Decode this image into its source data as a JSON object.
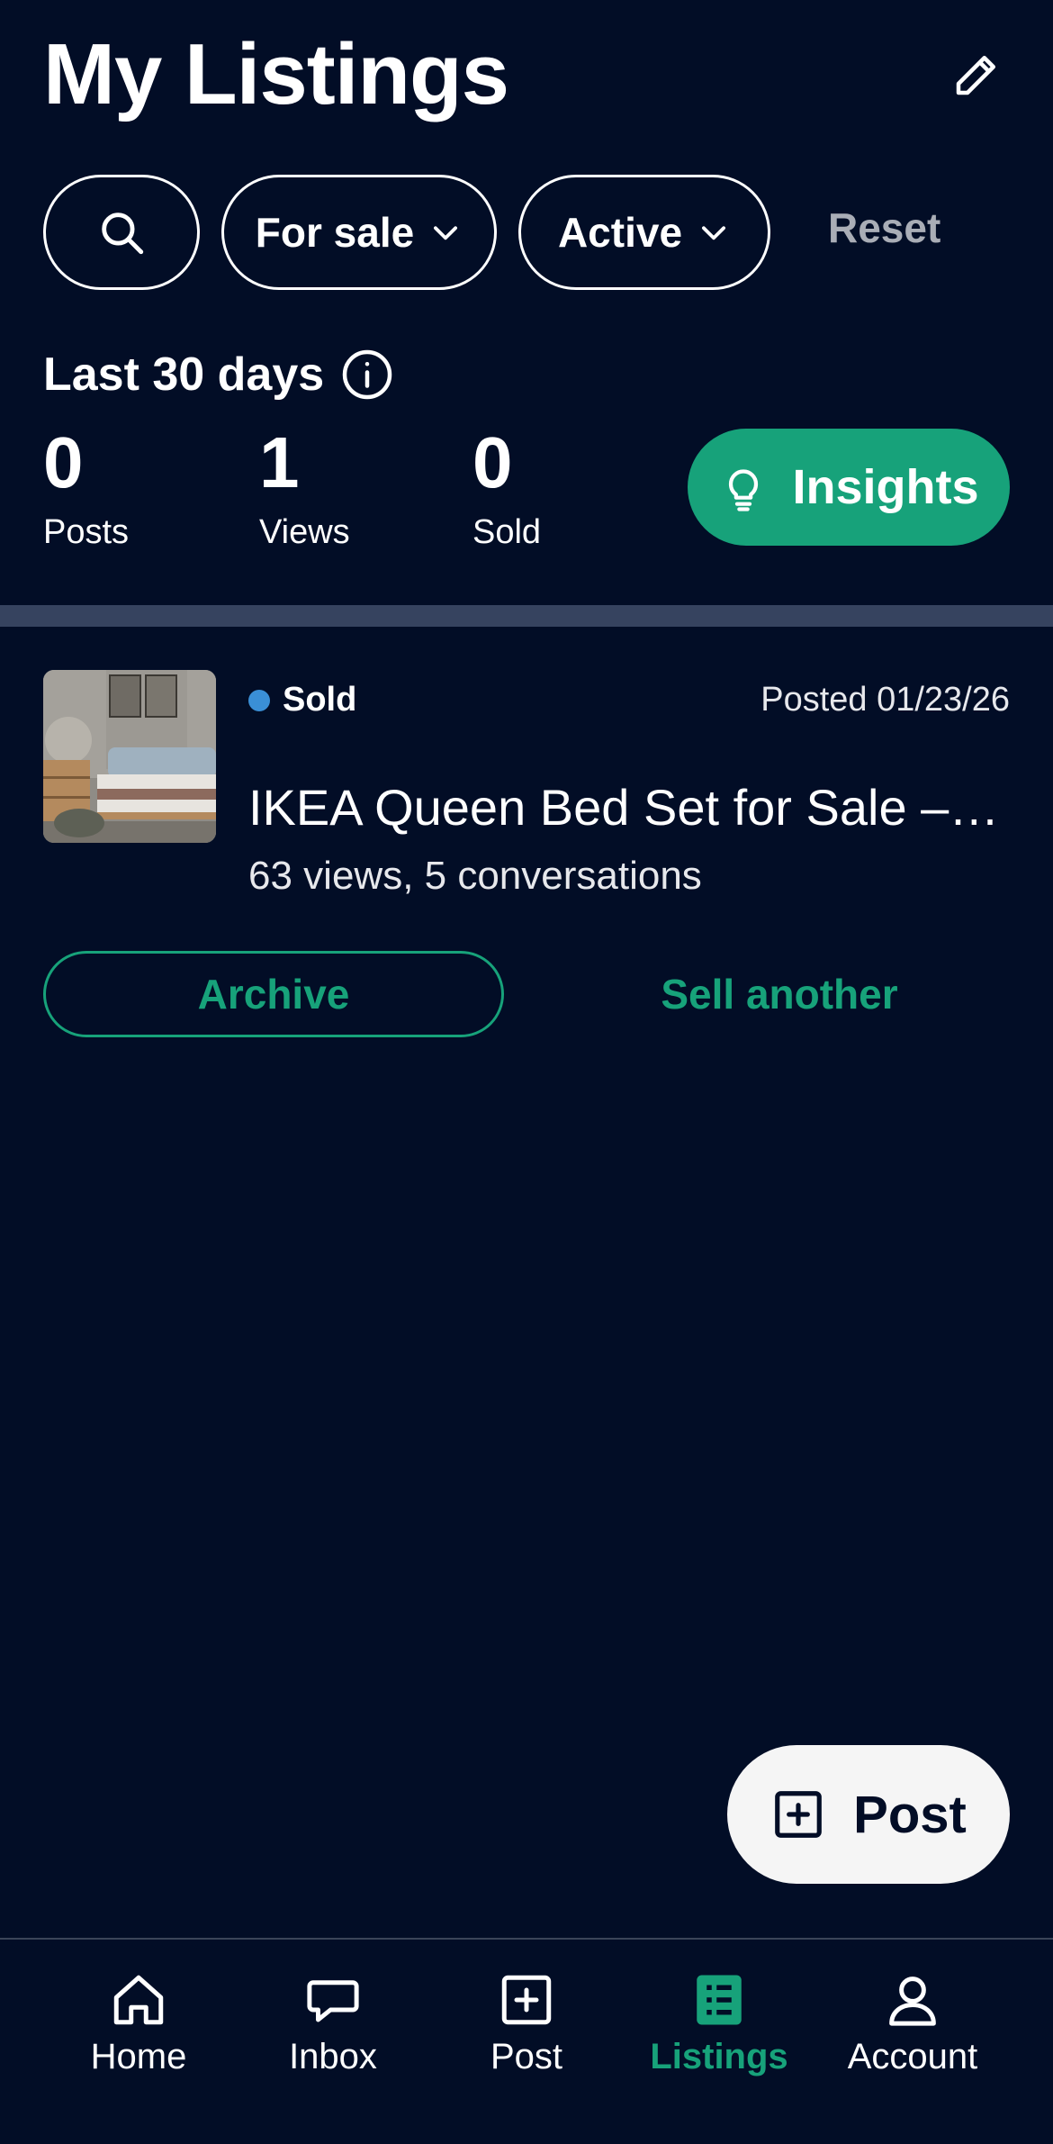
{
  "header": {
    "title": "My Listings",
    "edit_icon": "pencil-icon"
  },
  "filters": {
    "search_icon": "search-icon",
    "type_label": "For sale",
    "status_label": "Active",
    "reset_label": "Reset"
  },
  "stats": {
    "period_label": "Last 30 days",
    "info_icon": "info-icon",
    "posts_value": "0",
    "posts_label": "Posts",
    "views_value": "1",
    "views_label": "Views",
    "sold_value": "0",
    "sold_label": "Sold",
    "insights_label": "Insights",
    "insights_icon": "lightbulb-icon"
  },
  "listing": {
    "status": "Sold",
    "status_color": "#3a8fd6",
    "posted": "Posted 01/23/26",
    "title": "IKEA Queen Bed Set for Sale – Like New",
    "meta": "63 views, 5 conversations",
    "archive_label": "Archive",
    "sell_another_label": "Sell another"
  },
  "fab": {
    "label": "Post",
    "icon": "plus-square-icon"
  },
  "nav": {
    "items": [
      {
        "label": "Home",
        "icon": "home-icon"
      },
      {
        "label": "Inbox",
        "icon": "chat-bubble-icon"
      },
      {
        "label": "Post",
        "icon": "plus-square-icon"
      },
      {
        "label": "Listings",
        "icon": "list-icon",
        "active": true
      },
      {
        "label": "Account",
        "icon": "person-icon"
      }
    ]
  },
  "colors": {
    "background": "#020d26",
    "accent": "#17a27a",
    "divider": "#36435f"
  }
}
